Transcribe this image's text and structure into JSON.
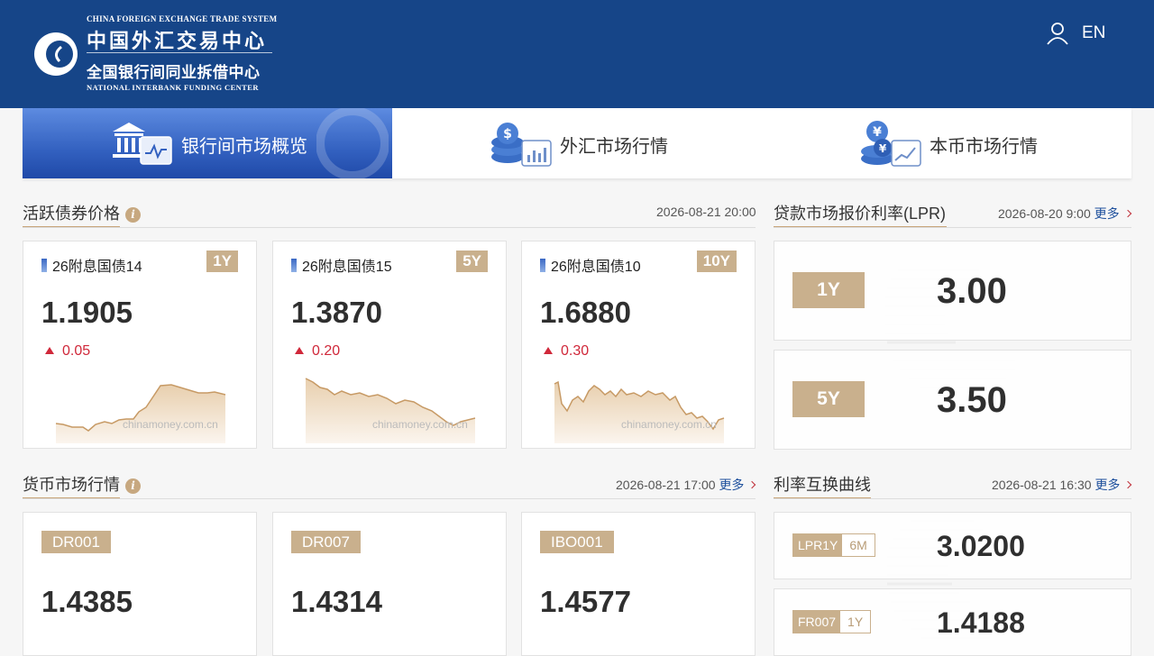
{
  "header": {
    "logo_en_top": "CHINA FOREIGN EXCHANGE TRADE SYSTEM",
    "logo_cn_top": "中国外汇交易中心",
    "logo_cn_bottom": "全国银行间同业拆借中心",
    "logo_en_bottom": "NATIONAL INTERBANK FUNDING CENTER",
    "language": "EN"
  },
  "tabs": [
    {
      "label": "银行间市场概览",
      "active": true
    },
    {
      "label": "外汇市场行情",
      "active": false
    },
    {
      "label": "本币市场行情",
      "active": false
    }
  ],
  "bonds": {
    "title": "活跃债券价格",
    "timestamp": "2026-08-21 20:00",
    "items": [
      {
        "name": "26附息国债14",
        "term": "1Y",
        "value": "1.1905",
        "change": "0.05",
        "watermark": "chinamoney.com.cn"
      },
      {
        "name": "26附息国债15",
        "term": "5Y",
        "value": "1.3870",
        "change": "0.20",
        "watermark": "chinamoney.com.cn"
      },
      {
        "name": "26附息国债10",
        "term": "10Y",
        "value": "1.6880",
        "change": "0.30",
        "watermark": "chinamoney.com.cn"
      }
    ]
  },
  "lpr": {
    "title": "贷款市场报价利率(LPR)",
    "timestamp": "2026-08-20 9:00",
    "more": "更多",
    "items": [
      {
        "term": "1Y",
        "value": "3.00"
      },
      {
        "term": "5Y",
        "value": "3.50"
      }
    ]
  },
  "money_market": {
    "title": "货币市场行情",
    "timestamp": "2026-08-21 17:00",
    "more": "更多",
    "items": [
      {
        "code": "DR001",
        "value": "1.4385"
      },
      {
        "code": "DR007",
        "value": "1.4314"
      },
      {
        "code": "IBO001",
        "value": "1.4577"
      }
    ]
  },
  "swap": {
    "title": "利率互换曲线",
    "timestamp": "2026-08-21 16:30",
    "more": "更多",
    "items": [
      {
        "name": "LPR1Y",
        "tenor": "6M",
        "value": "3.0200"
      },
      {
        "name": "FR007",
        "tenor": "1Y",
        "value": "1.4188"
      }
    ]
  },
  "colors": {
    "header_bg": "#164588",
    "accent_gold": "#c9b08d",
    "up_red": "#d0283a",
    "link_blue": "#1d4f9c"
  }
}
